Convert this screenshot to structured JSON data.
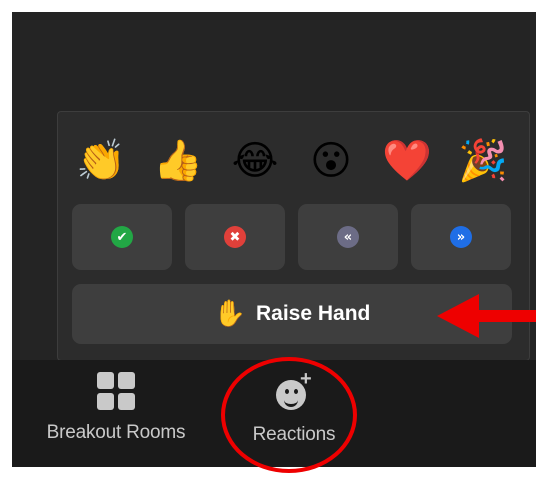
{
  "reactions_panel": {
    "emojis": [
      {
        "glyph": "👏",
        "icon": "clap-emoji"
      },
      {
        "glyph": "👍",
        "icon": "thumbs-up-emoji"
      },
      {
        "glyph": "😂",
        "icon": "tears-of-joy-emoji"
      },
      {
        "glyph": "😮",
        "icon": "open-mouth-emoji"
      },
      {
        "glyph": "❤️",
        "icon": "red-heart-emoji"
      },
      {
        "glyph": "🎉",
        "icon": "party-popper-emoji"
      }
    ],
    "status_buttons": [
      {
        "name": "yes",
        "glyph": "✔",
        "color": "#22a745"
      },
      {
        "name": "no",
        "glyph": "✖",
        "color": "#e0403a"
      },
      {
        "name": "slow-down",
        "glyph": "«",
        "color": "#6c6c86"
      },
      {
        "name": "speed-up",
        "glyph": "»",
        "color": "#1f6ee6"
      }
    ],
    "raise_hand": {
      "glyph": "✋",
      "label": "Raise Hand"
    }
  },
  "toolbar": {
    "breakout_rooms": {
      "label": "Breakout Rooms",
      "icon": "grid-icon"
    },
    "reactions": {
      "label": "Reactions",
      "icon": "smiley-plus-icon"
    }
  },
  "annotations": {
    "color": "#ee0000",
    "arrow": "red-arrow",
    "circle": "red-circle"
  }
}
